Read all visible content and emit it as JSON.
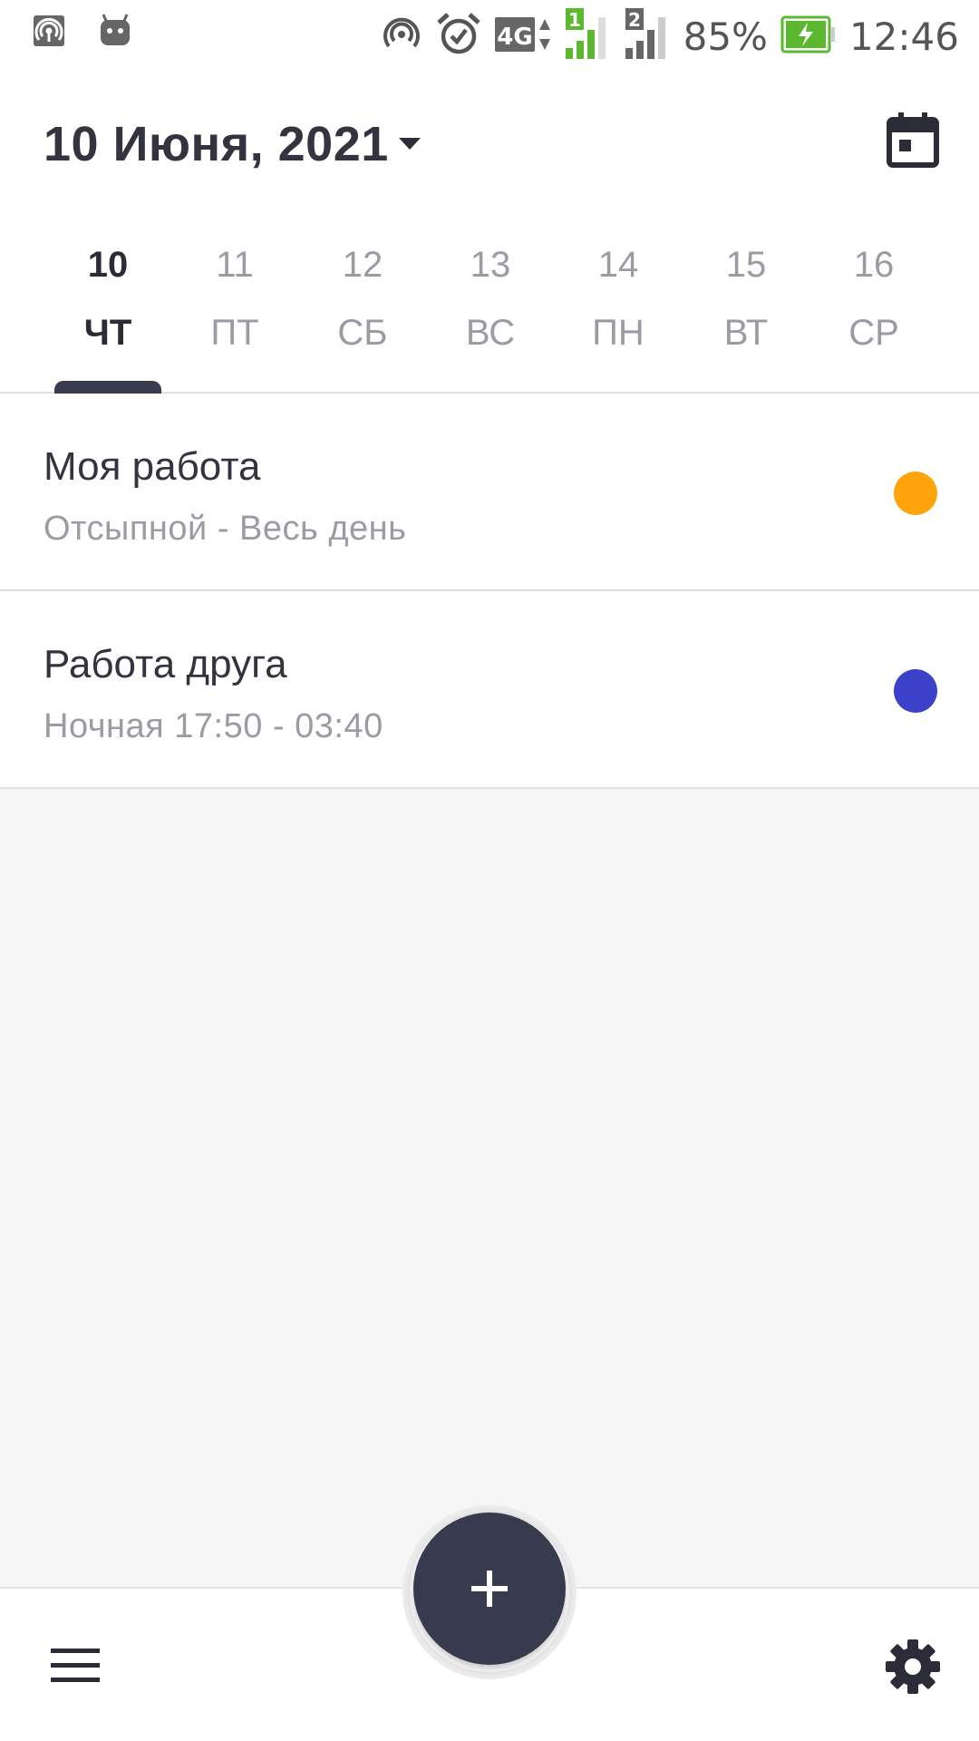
{
  "status_bar": {
    "battery": "85%",
    "time": "12:46",
    "network": "4G",
    "sim1": "1",
    "sim2": "2",
    "icons": [
      "hotspot-icon",
      "android-icon",
      "wireless-icon",
      "alarm-icon",
      "4g-icon",
      "signal-sim1-icon",
      "signal-sim2-icon",
      "battery-charging-icon"
    ]
  },
  "header": {
    "date_title": "10 Июня, 2021",
    "dropdown_icon": "caret-down-icon",
    "calendar_icon": "calendar-icon"
  },
  "day_tabs": [
    {
      "num": "10",
      "name": "ЧТ",
      "active": true
    },
    {
      "num": "11",
      "name": "ПТ",
      "active": false
    },
    {
      "num": "12",
      "name": "СБ",
      "active": false
    },
    {
      "num": "13",
      "name": "ВС",
      "active": false
    },
    {
      "num": "14",
      "name": "ПН",
      "active": false
    },
    {
      "num": "15",
      "name": "ВТ",
      "active": false
    },
    {
      "num": "16",
      "name": "СР",
      "active": false
    }
  ],
  "items": [
    {
      "title": "Моя работа",
      "subtitle": "Отсыпной - Весь день",
      "color": "#ffa40c"
    },
    {
      "title": "Работа друга",
      "subtitle": "Ночная 17:50 - 03:40",
      "color": "#3c41c9"
    }
  ],
  "bottom_bar": {
    "menu_icon": "hamburger-menu-icon",
    "add_icon": "plus-icon",
    "settings_icon": "gear-icon"
  },
  "colors": {
    "accent_dark": "#383b4d",
    "text_primary": "#2b2c37",
    "text_secondary": "#9b9ca3",
    "background_gray": "#f6f6f6"
  }
}
